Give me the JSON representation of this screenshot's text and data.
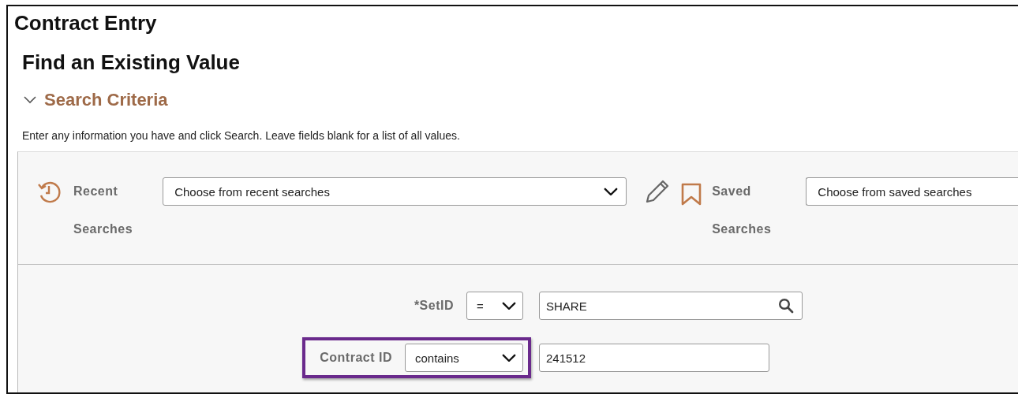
{
  "page": {
    "title": "Contract Entry",
    "heading": "Find an Existing Value"
  },
  "section": {
    "title": "Search Criteria",
    "expanded": true,
    "instructions": "Enter any information you have and click Search. Leave fields blank for a list of all values."
  },
  "recent_searches": {
    "label_line_1": "Recent",
    "label_line_2": "Searches",
    "placeholder": "Choose from recent searches"
  },
  "saved_searches": {
    "label_line_1": "Saved",
    "label_line_2": "Searches",
    "placeholder": "Choose from saved searches"
  },
  "criteria": [
    {
      "label": "*SetID",
      "operator": "=",
      "value": "SHARE",
      "lookup": true,
      "highlighted": false
    },
    {
      "label": "Contract ID",
      "operator": "contains",
      "value": "241512",
      "lookup": false,
      "highlighted": true
    }
  ]
}
